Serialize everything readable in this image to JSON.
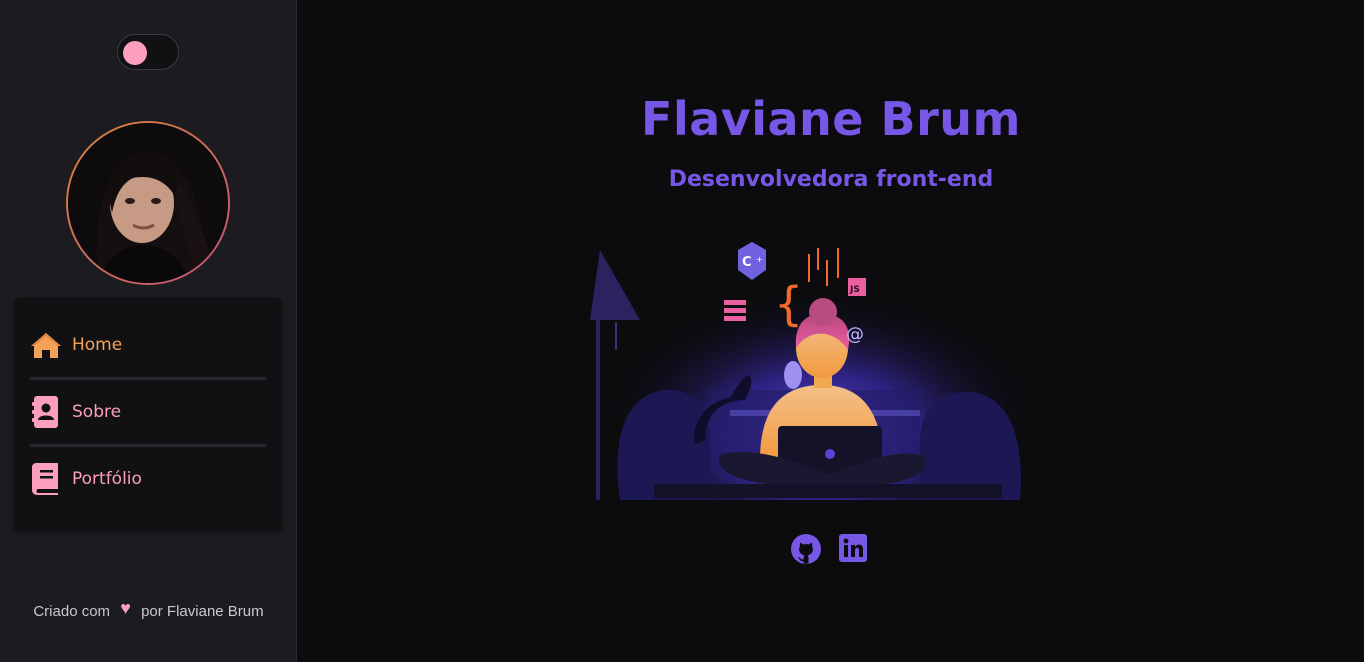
{
  "theme_toggle": {
    "state": "dark",
    "knob_color": "#fc9fbc"
  },
  "profile": {
    "avatar_alt": "Flaviane Brum"
  },
  "nav": {
    "items": [
      {
        "label": "Home",
        "icon": "house-icon",
        "color": "#f4a259"
      },
      {
        "label": "Sobre",
        "icon": "contact-card-icon",
        "color": "#fc9fbc"
      },
      {
        "label": "Portfólio",
        "icon": "book-icon",
        "color": "#fc9fbc"
      }
    ]
  },
  "footer": {
    "prefix": "Criado com",
    "suffix": "por Flaviane Brum",
    "heart_icon": "heart-icon"
  },
  "hero": {
    "name": "Flaviane Brum",
    "role": "Desenvolvedora front-end",
    "accent": "#7657e6"
  },
  "social": [
    {
      "icon": "github-icon"
    },
    {
      "icon": "linkedin-icon"
    }
  ]
}
